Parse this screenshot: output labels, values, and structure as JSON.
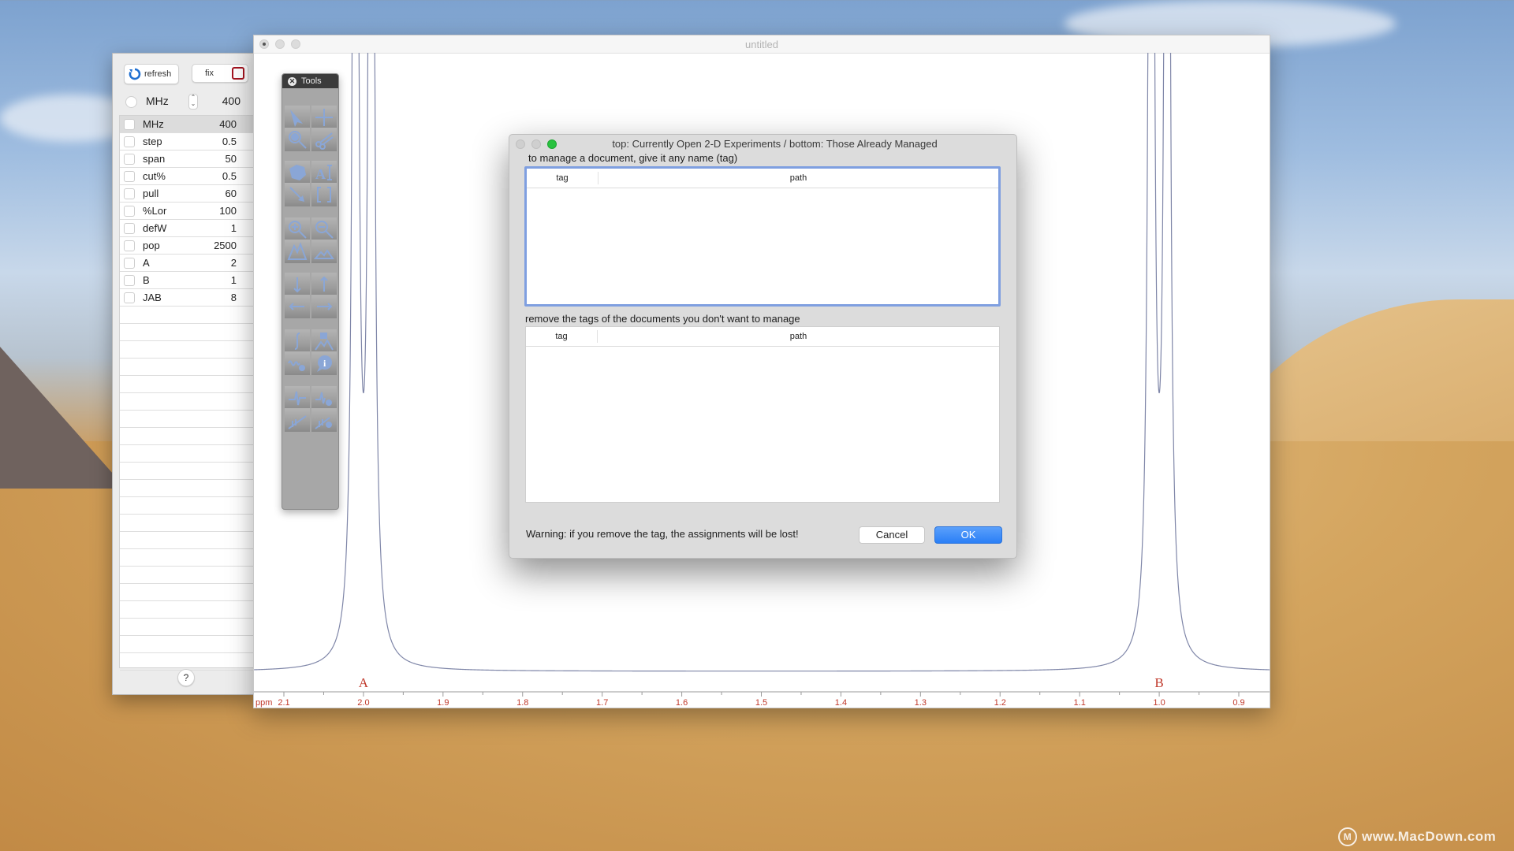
{
  "panel": {
    "refresh_label": "refresh",
    "fix_label": "fix",
    "mhz_label": "MHz",
    "mhz_value": "400",
    "params": [
      {
        "name": "MHz",
        "value": "400",
        "selected": true
      },
      {
        "name": "step",
        "value": "0.5"
      },
      {
        "name": "span",
        "value": "50"
      },
      {
        "name": "cut%",
        "value": "0.5"
      },
      {
        "name": "pull",
        "value": "60"
      },
      {
        "name": "%Lor",
        "value": "100"
      },
      {
        "name": "defW",
        "value": "1"
      },
      {
        "name": " pop",
        "value": "2500"
      },
      {
        "name": " A",
        "value": "2"
      },
      {
        "name": " B",
        "value": "1"
      },
      {
        "name": " JAB",
        "value": "8"
      }
    ],
    "empty_rows": 21,
    "help_label": "?"
  },
  "window": {
    "title": "untitled"
  },
  "tools": {
    "title": "Tools",
    "close_glyph": "✕",
    "buttons": [
      {
        "icon": "select-arrow-icon"
      },
      {
        "icon": "crosshair-icon"
      },
      {
        "icon": "magnifier-icon"
      },
      {
        "icon": "scissors-icon"
      },
      {
        "icon": "molecule-icon"
      },
      {
        "icon": "text-tool-icon"
      },
      {
        "icon": "annotation-arrow-icon"
      },
      {
        "icon": "brackets-icon"
      },
      {
        "icon": "zoom-in-icon"
      },
      {
        "icon": "zoom-out-icon"
      },
      {
        "icon": "peaks-tall-icon"
      },
      {
        "icon": "peaks-short-icon"
      },
      {
        "icon": "arrow-down-icon"
      },
      {
        "icon": "arrow-up-icon"
      },
      {
        "icon": "arrow-left-icon"
      },
      {
        "icon": "arrow-right-icon"
      },
      {
        "icon": "integral-icon"
      },
      {
        "icon": "peak-pick-icon"
      },
      {
        "icon": "fid-settings-icon"
      },
      {
        "icon": "info-bubble-icon"
      },
      {
        "icon": "phase-icon"
      },
      {
        "icon": "phase-settings-icon"
      },
      {
        "icon": "baseline-icon"
      },
      {
        "icon": "baseline-settings-icon"
      }
    ]
  },
  "dialog": {
    "title": "top: Currently Open 2-D Experiments / bottom: Those Already Managed",
    "top_label": "to manage a document, give it any name (tag)",
    "bottom_label": "remove the tags of the documents you don't want to manage",
    "col_tag": "tag",
    "col_path": "path",
    "top_rows": [],
    "bottom_rows": [],
    "warning": "Warning: if you remove the tag, the assignments will be lost!",
    "cancel_label": "Cancel",
    "ok_label": "OK"
  },
  "chart_data": {
    "type": "line",
    "title": "",
    "xlabel": "ppm",
    "ylabel": "",
    "xlim": [
      2.11,
      0.87
    ],
    "x_ticks": [
      "2.1",
      "2.0",
      "1.9",
      "1.8",
      "1.7",
      "1.6",
      "1.5",
      "1.4",
      "1.3",
      "1.2",
      "1.1",
      "1.0",
      "0.9"
    ],
    "peaks": [
      {
        "label": "A",
        "center_ppm": 2.0,
        "lines_ppm": [
          2.01,
          1.99
        ]
      },
      {
        "label": "B",
        "center_ppm": 1.0,
        "lines_ppm": [
          1.01,
          0.99
        ]
      }
    ],
    "line_color": "#7f86a8",
    "axis_color": "#c0392b"
  },
  "watermark": "www.MacDown.com"
}
